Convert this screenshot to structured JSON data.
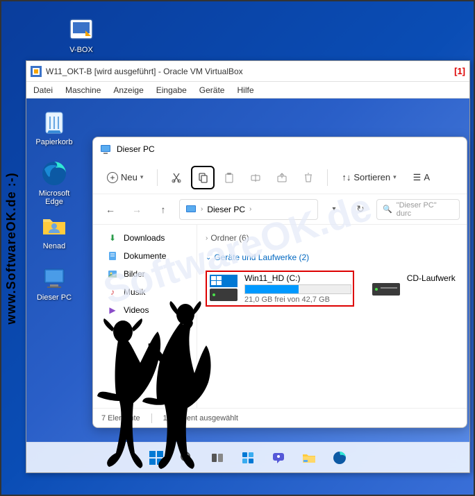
{
  "desktop": {
    "vbox_label": "V-BOX"
  },
  "vbox_window": {
    "title": "W11_OKT-B  [wird ausgeführt] - Oracle VM VirtualBox",
    "annotation": "[1]",
    "menu": {
      "file": "Datei",
      "machine": "Maschine",
      "view": "Anzeige",
      "input": "Eingabe",
      "devices": "Geräte",
      "help": "Hilfe"
    }
  },
  "vm_desktop": {
    "recycle": "Papierkorb",
    "edge": "Microsoft Edge",
    "user": "Nenad",
    "this_pc": "Dieser PC"
  },
  "explorer": {
    "title": "Dieser PC",
    "toolbar": {
      "new": "Neu",
      "sort": "Sortieren",
      "view_short": "A"
    },
    "nav": {
      "breadcrumb": "Dieser PC",
      "search_placeholder": "\"Dieser PC\" durc"
    },
    "sidebar": {
      "downloads": "Downloads",
      "documents": "Dokumente",
      "pictures": "Bilder",
      "music": "Musik",
      "videos": "Videos"
    },
    "content": {
      "folders_group": "Ordner (6)",
      "devices_group": "Geräte und Laufwerke (2)",
      "drive_c": {
        "name": "Win11_HD (C:)",
        "status": "21,0 GB frei von 42,7 GB",
        "fill_percent": 51
      },
      "drive_cd": {
        "name": "CD-Laufwerk"
      }
    },
    "statusbar": {
      "items": "7 Elemente",
      "selected": "1 Element ausgewählt"
    }
  },
  "watermark": {
    "side": "www.SoftwareOK.de  :-)",
    "diag": "SoftwareOK.de"
  }
}
